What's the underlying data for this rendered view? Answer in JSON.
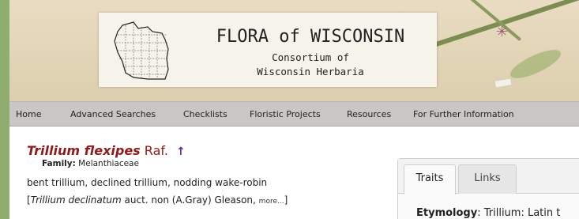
{
  "header": {
    "title": "FLORA of WISCONSIN",
    "subtitle_line1": "Consortium of",
    "subtitle_line2": "Wisconsin Herbaria",
    "map_icon": "wisconsin-map-icon"
  },
  "nav": {
    "items": [
      {
        "label": "Home"
      },
      {
        "label": "Advanced Searches"
      },
      {
        "label": "Checklists"
      },
      {
        "label": "Floristic Projects"
      },
      {
        "label": "Resources"
      },
      {
        "label": "For Further Information"
      }
    ]
  },
  "taxon": {
    "scientific_name": "Trillium flexipes",
    "author": "Raf.",
    "parent_arrow_icon": "up-arrow-icon",
    "family_label": "Family:",
    "family": "Melanthiaceae",
    "common_names": "bent trillium, declined trillium, nodding wake-robin",
    "synonym_open": "[",
    "synonym_name": "Trillium declinatum",
    "synonym_rest": " auct. non (A.Gray) Gleason,",
    "synonym_more": "more...",
    "synonym_close": "]"
  },
  "panel": {
    "tabs": [
      {
        "label": "Traits",
        "active": true
      },
      {
        "label": "Links",
        "active": false
      }
    ],
    "etymology_label": "Etymology",
    "etymology_text": ": Trillium: Latin t"
  },
  "colors": {
    "accent_green": "#8fad6e",
    "taxon_red": "#8e1b1b",
    "arrow_purple": "#6a2a8a",
    "nav_gray": "#c9c7c4"
  }
}
